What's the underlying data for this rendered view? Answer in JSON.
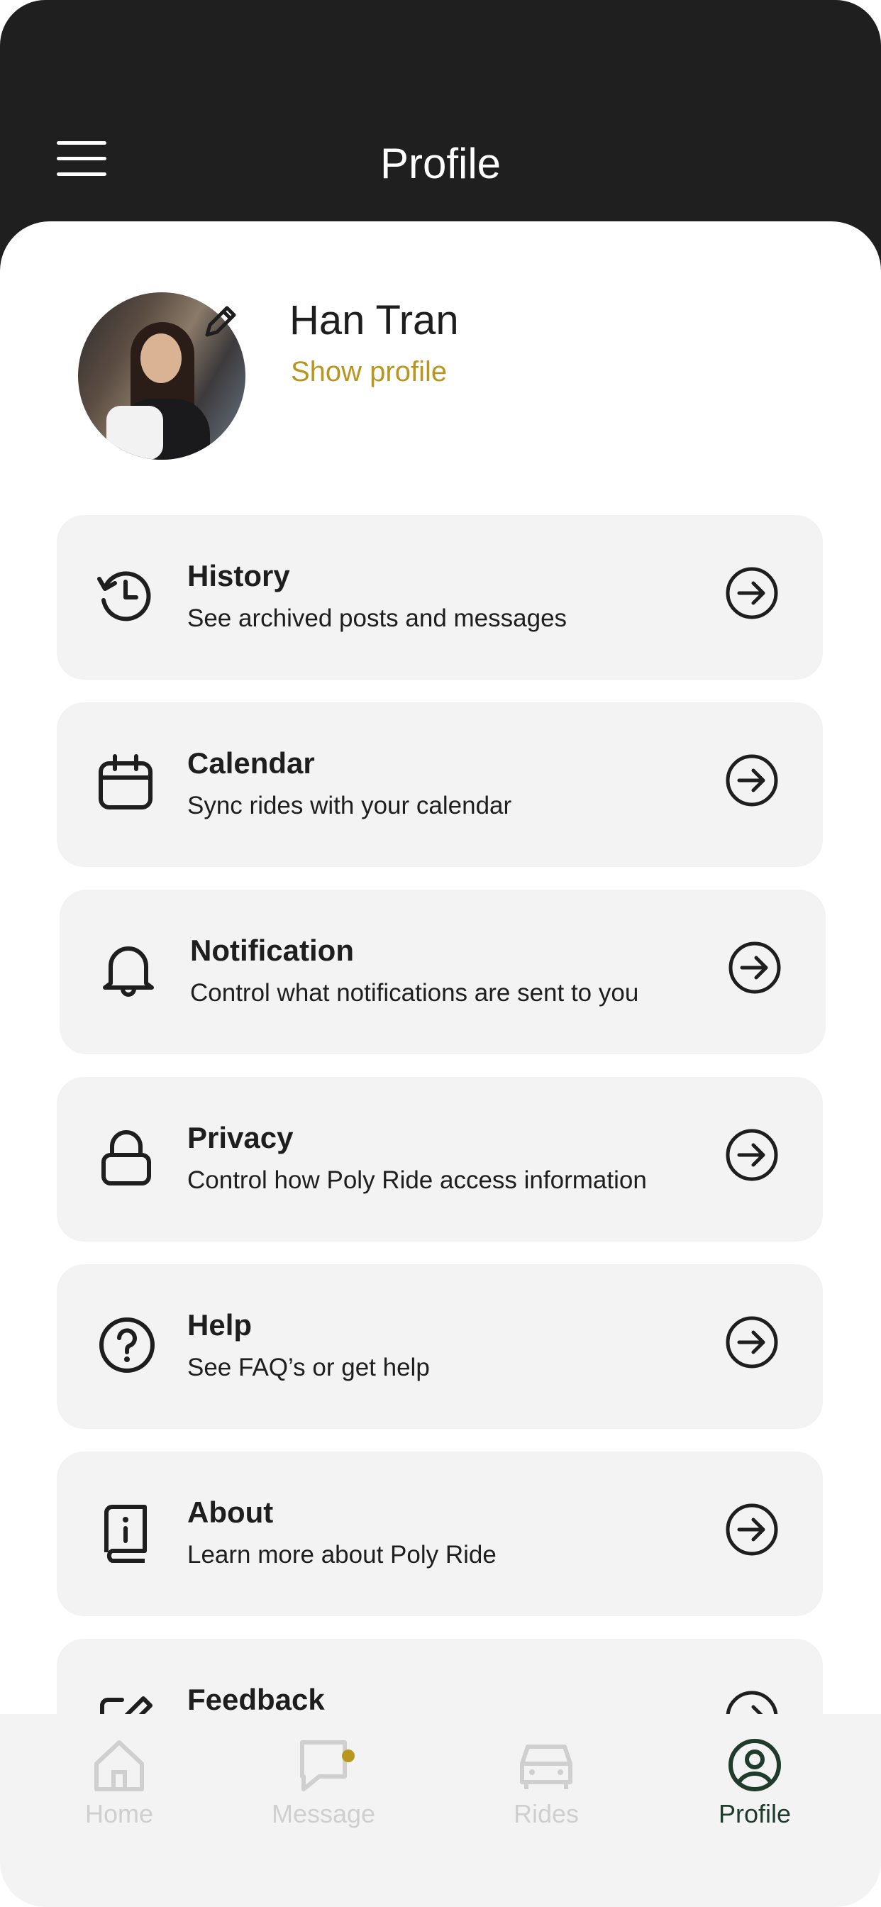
{
  "header": {
    "title": "Profile"
  },
  "user": {
    "name": "Han Tran",
    "show_profile_label": "Show profile"
  },
  "menu": [
    {
      "title": "History",
      "subtitle": "See archived posts and messages",
      "icon": "history-icon"
    },
    {
      "title": "Calendar",
      "subtitle": "Sync rides with your calendar",
      "icon": "calendar-icon"
    },
    {
      "title": "Notification",
      "subtitle": "Control what notifications are sent to you",
      "icon": "bell-icon"
    },
    {
      "title": "Privacy",
      "subtitle": "Control how Poly Ride access information",
      "icon": "lock-icon"
    },
    {
      "title": "Help",
      "subtitle": "See FAQ’s or get help",
      "icon": "help-icon"
    },
    {
      "title": "About",
      "subtitle": "Learn more about Poly Ride",
      "icon": "book-info-icon"
    },
    {
      "title": "Feedback",
      "subtitle": "",
      "icon": "feedback-edit-icon"
    }
  ],
  "bottom_nav": [
    {
      "label": "Home",
      "icon": "home-icon",
      "active": false
    },
    {
      "label": "Message",
      "icon": "message-icon",
      "active": false,
      "badge": true
    },
    {
      "label": "Rides",
      "icon": "car-icon",
      "active": false
    },
    {
      "label": "Profile",
      "icon": "profile-icon",
      "active": true
    }
  ],
  "colors": {
    "header_bg": "#1f1f1f",
    "accent": "#b8961f",
    "card_bg": "#f3f3f3",
    "active_nav": "#1f3b2c",
    "inactive_nav": "#cfcfcf"
  }
}
